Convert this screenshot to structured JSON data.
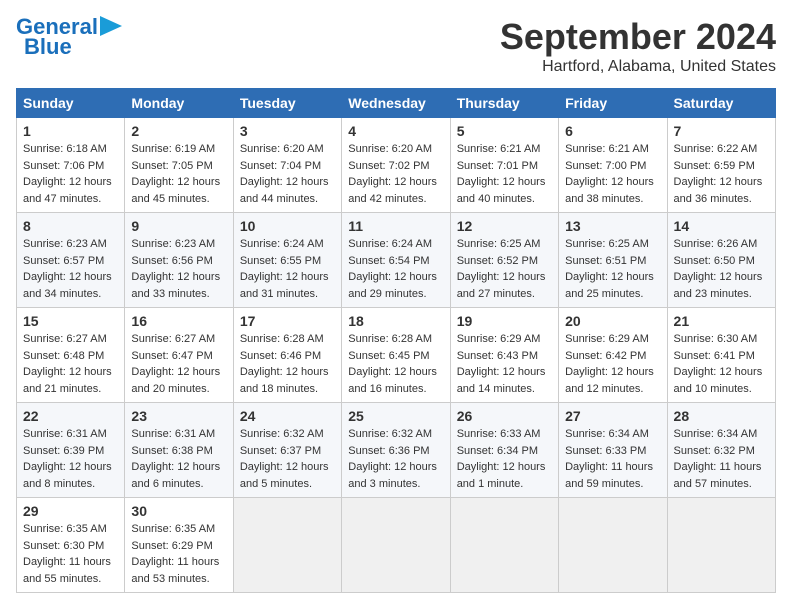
{
  "header": {
    "logo_general": "General",
    "logo_blue": "Blue",
    "month": "September 2024",
    "location": "Hartford, Alabama, United States"
  },
  "days_of_week": [
    "Sunday",
    "Monday",
    "Tuesday",
    "Wednesday",
    "Thursday",
    "Friday",
    "Saturday"
  ],
  "weeks": [
    [
      {
        "day": "1",
        "info": "Sunrise: 6:18 AM\nSunset: 7:06 PM\nDaylight: 12 hours\nand 47 minutes."
      },
      {
        "day": "2",
        "info": "Sunrise: 6:19 AM\nSunset: 7:05 PM\nDaylight: 12 hours\nand 45 minutes."
      },
      {
        "day": "3",
        "info": "Sunrise: 6:20 AM\nSunset: 7:04 PM\nDaylight: 12 hours\nand 44 minutes."
      },
      {
        "day": "4",
        "info": "Sunrise: 6:20 AM\nSunset: 7:02 PM\nDaylight: 12 hours\nand 42 minutes."
      },
      {
        "day": "5",
        "info": "Sunrise: 6:21 AM\nSunset: 7:01 PM\nDaylight: 12 hours\nand 40 minutes."
      },
      {
        "day": "6",
        "info": "Sunrise: 6:21 AM\nSunset: 7:00 PM\nDaylight: 12 hours\nand 38 minutes."
      },
      {
        "day": "7",
        "info": "Sunrise: 6:22 AM\nSunset: 6:59 PM\nDaylight: 12 hours\nand 36 minutes."
      }
    ],
    [
      {
        "day": "8",
        "info": "Sunrise: 6:23 AM\nSunset: 6:57 PM\nDaylight: 12 hours\nand 34 minutes."
      },
      {
        "day": "9",
        "info": "Sunrise: 6:23 AM\nSunset: 6:56 PM\nDaylight: 12 hours\nand 33 minutes."
      },
      {
        "day": "10",
        "info": "Sunrise: 6:24 AM\nSunset: 6:55 PM\nDaylight: 12 hours\nand 31 minutes."
      },
      {
        "day": "11",
        "info": "Sunrise: 6:24 AM\nSunset: 6:54 PM\nDaylight: 12 hours\nand 29 minutes."
      },
      {
        "day": "12",
        "info": "Sunrise: 6:25 AM\nSunset: 6:52 PM\nDaylight: 12 hours\nand 27 minutes."
      },
      {
        "day": "13",
        "info": "Sunrise: 6:25 AM\nSunset: 6:51 PM\nDaylight: 12 hours\nand 25 minutes."
      },
      {
        "day": "14",
        "info": "Sunrise: 6:26 AM\nSunset: 6:50 PM\nDaylight: 12 hours\nand 23 minutes."
      }
    ],
    [
      {
        "day": "15",
        "info": "Sunrise: 6:27 AM\nSunset: 6:48 PM\nDaylight: 12 hours\nand 21 minutes."
      },
      {
        "day": "16",
        "info": "Sunrise: 6:27 AM\nSunset: 6:47 PM\nDaylight: 12 hours\nand 20 minutes."
      },
      {
        "day": "17",
        "info": "Sunrise: 6:28 AM\nSunset: 6:46 PM\nDaylight: 12 hours\nand 18 minutes."
      },
      {
        "day": "18",
        "info": "Sunrise: 6:28 AM\nSunset: 6:45 PM\nDaylight: 12 hours\nand 16 minutes."
      },
      {
        "day": "19",
        "info": "Sunrise: 6:29 AM\nSunset: 6:43 PM\nDaylight: 12 hours\nand 14 minutes."
      },
      {
        "day": "20",
        "info": "Sunrise: 6:29 AM\nSunset: 6:42 PM\nDaylight: 12 hours\nand 12 minutes."
      },
      {
        "day": "21",
        "info": "Sunrise: 6:30 AM\nSunset: 6:41 PM\nDaylight: 12 hours\nand 10 minutes."
      }
    ],
    [
      {
        "day": "22",
        "info": "Sunrise: 6:31 AM\nSunset: 6:39 PM\nDaylight: 12 hours\nand 8 minutes."
      },
      {
        "day": "23",
        "info": "Sunrise: 6:31 AM\nSunset: 6:38 PM\nDaylight: 12 hours\nand 6 minutes."
      },
      {
        "day": "24",
        "info": "Sunrise: 6:32 AM\nSunset: 6:37 PM\nDaylight: 12 hours\nand 5 minutes."
      },
      {
        "day": "25",
        "info": "Sunrise: 6:32 AM\nSunset: 6:36 PM\nDaylight: 12 hours\nand 3 minutes."
      },
      {
        "day": "26",
        "info": "Sunrise: 6:33 AM\nSunset: 6:34 PM\nDaylight: 12 hours\nand 1 minute."
      },
      {
        "day": "27",
        "info": "Sunrise: 6:34 AM\nSunset: 6:33 PM\nDaylight: 11 hours\nand 59 minutes."
      },
      {
        "day": "28",
        "info": "Sunrise: 6:34 AM\nSunset: 6:32 PM\nDaylight: 11 hours\nand 57 minutes."
      }
    ],
    [
      {
        "day": "29",
        "info": "Sunrise: 6:35 AM\nSunset: 6:30 PM\nDaylight: 11 hours\nand 55 minutes."
      },
      {
        "day": "30",
        "info": "Sunrise: 6:35 AM\nSunset: 6:29 PM\nDaylight: 11 hours\nand 53 minutes."
      },
      {
        "day": "",
        "info": ""
      },
      {
        "day": "",
        "info": ""
      },
      {
        "day": "",
        "info": ""
      },
      {
        "day": "",
        "info": ""
      },
      {
        "day": "",
        "info": ""
      }
    ]
  ]
}
